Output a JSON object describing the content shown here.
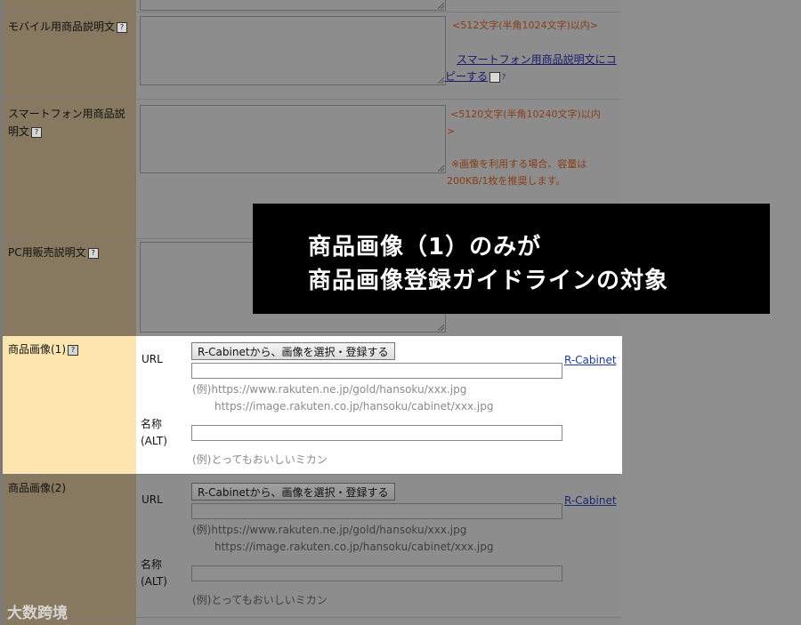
{
  "rows": {
    "mobile_desc": {
      "label": "モバイル用商品説明文",
      "note1": "<512文字(半角1024文字)以内>",
      "copy_link": "スマートフォン用商品説明文にコピーする"
    },
    "sp_desc": {
      "label_line1": "スマートフォン用商品説",
      "label_line2": "明文",
      "note1": "<5120文字(半角10240文字)以内",
      "note2": ">",
      "note3": "※画像を利用する場合、容量は",
      "note4": "200KB/1枚を推奨します。"
    },
    "pc_sales_desc": {
      "label": "PC用販売説明文"
    }
  },
  "overlay": {
    "line1": "商品画像（1）のみが",
    "line2": "商品画像登録ガイドラインの対象"
  },
  "image1": {
    "label": "商品画像(1)",
    "url_label": "URL",
    "select_button": "R-Cabinetから、画像を選択・登録する",
    "rcabinet_link": "R-Cabinet",
    "url_value": "",
    "example_url1": "(例)https://www.rakuten.ne.jp/gold/hansoku/xxx.jpg",
    "example_url2": "https://image.rakuten.co.jp/hansoku/cabinet/xxx.jpg",
    "name_label_line1": "名称",
    "name_label_line2": "(ALT)",
    "alt_value": "",
    "example_alt": "(例)とってもおいしいミカン"
  },
  "image2": {
    "label": "商品画像(2)",
    "url_label": "URL",
    "select_button": "R-Cabinetから、画像を選択・登録する",
    "rcabinet_link": "R-Cabinet",
    "example_url1": "(例)https://www.rakuten.ne.jp/gold/hansoku/xxx.jpg",
    "example_url2": "https://image.rakuten.co.jp/hansoku/cabinet/xxx.jpg",
    "name_label_line1": "名称",
    "name_label_line2": "(ALT)",
    "example_alt": "(例)とってもおいしいミカン"
  },
  "watermark": "大数跨境",
  "help_icon_glyph": "?"
}
